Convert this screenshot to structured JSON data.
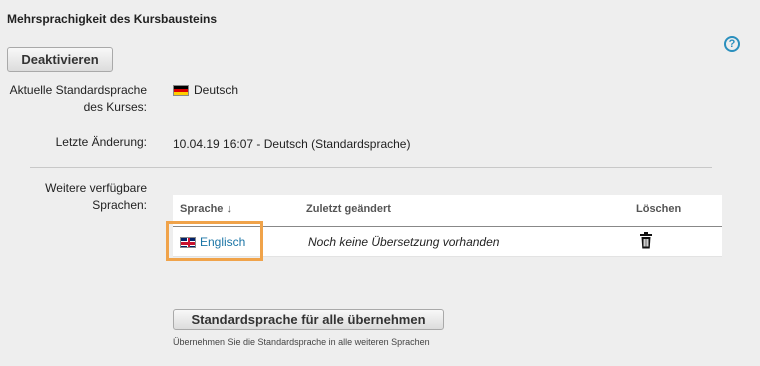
{
  "panel": {
    "title": "Mehrsprachigkeit des Kursbausteins",
    "help_icon": "question-circle-icon"
  },
  "buttons": {
    "deactivate": "Deaktivieren",
    "apply_default": "Standardsprache für alle übernehmen"
  },
  "current_language": {
    "label": "Aktuelle Standardsprache des Kurses:",
    "value": "Deutsch",
    "flag": "flag-de-icon"
  },
  "last_change": {
    "label": "Letzte Änderung:",
    "value": "10.04.19 16:07 - Deutsch (Standardsprache)"
  },
  "further_languages": {
    "label": "Weitere verfügbare Sprachen:",
    "columns": {
      "language": "Sprache ↓",
      "last_changed": "Zuletzt geändert",
      "delete": "Löschen"
    },
    "rows": [
      {
        "language": "Englisch",
        "flag": "flag-uk-icon",
        "last_changed": "Noch keine Übersetzung vorhanden",
        "delete_icon": "trash-icon"
      }
    ]
  },
  "hint": "Übernehmen Sie die Standardsprache in alle weiteren Sprachen",
  "colors": {
    "link": "#1b75a6",
    "highlight": "#f0a34a",
    "help": "#2a8fbd"
  }
}
